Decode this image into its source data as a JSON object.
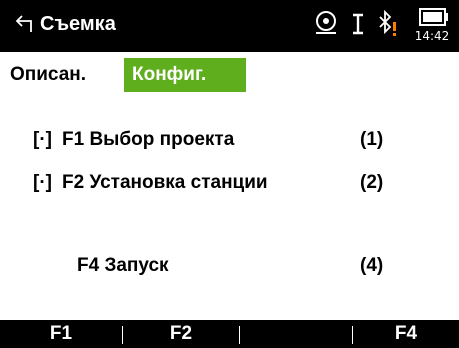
{
  "titlebar": {
    "title": "Съемка",
    "clock": "14:42",
    "icons": [
      "back-arrow-icon",
      "prism-target-icon",
      "ibeam-cursor-icon",
      "bluetooth-warning-icon",
      "battery-icon"
    ]
  },
  "tabs": [
    {
      "label": "Описан.",
      "active": false
    },
    {
      "label": "Конфиг.",
      "active": true
    }
  ],
  "menu": {
    "items": [
      {
        "mark": "[·]",
        "label": "F1 Выбор проекта",
        "number": "(1)"
      },
      {
        "mark": "[·]",
        "label": "F2 Установка станции",
        "number": "(2)"
      },
      {
        "mark": "",
        "label": "F4 Запуск",
        "number": "(4)"
      }
    ]
  },
  "fkeys": {
    "f1": "F1",
    "f2": "F2",
    "f3": "",
    "f4": "F4"
  },
  "colors": {
    "accent": "#5fae1e",
    "bar": "#000000",
    "warning": "#ff7a00"
  }
}
